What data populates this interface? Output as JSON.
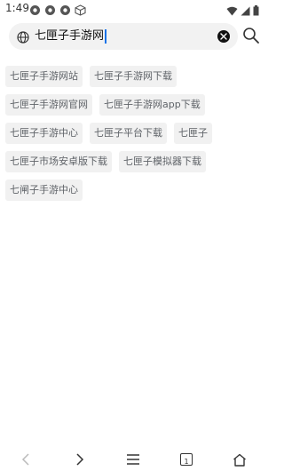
{
  "status_bar": {
    "time": "1:49"
  },
  "search": {
    "query": "七匣子手游网",
    "globe_icon": "globe-icon",
    "clear_icon": "clear-icon",
    "search_icon": "search-icon"
  },
  "suggestions": [
    {
      "label": "七匣子手游网站"
    },
    {
      "label": "七匣子手游网下载"
    },
    {
      "label": "七匣子手游网官网"
    },
    {
      "label": "七匣子手游网app下载"
    },
    {
      "label": "七匣子手游中心"
    },
    {
      "label": "七匣子平台下载"
    },
    {
      "label": "七匣子"
    },
    {
      "label": "七匣子市场安卓版下载"
    },
    {
      "label": "七匣子模拟器下载"
    },
    {
      "label": "七闸子手游中心"
    }
  ],
  "bottom_nav": {
    "tab_count": "1"
  },
  "colors": {
    "accent": "#1a73e8",
    "chip_bg": "#f1f1f1",
    "chip_text": "#5f6368",
    "search_bg": "#f2f2f2"
  }
}
